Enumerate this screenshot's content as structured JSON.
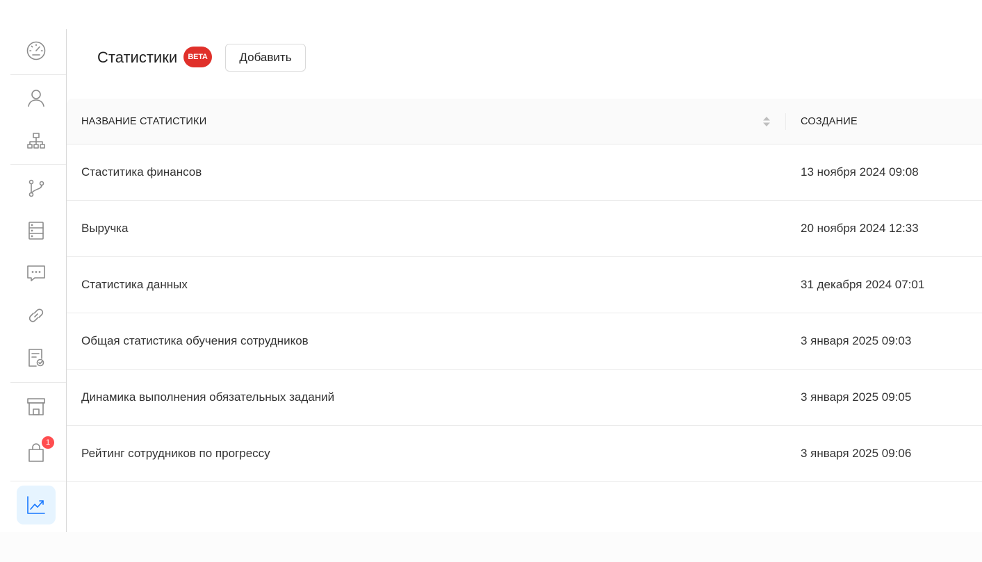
{
  "header": {
    "title": "Статистики",
    "beta_label": "BETA",
    "add_button_label": "Добавить"
  },
  "sidebar": {
    "items": [
      {
        "name": "dashboard",
        "icon": "speedometer-icon"
      },
      {
        "name": "users",
        "icon": "user-icon"
      },
      {
        "name": "structure",
        "icon": "org-chart-icon"
      },
      {
        "name": "branches",
        "icon": "branch-icon"
      },
      {
        "name": "database",
        "icon": "server-icon"
      },
      {
        "name": "messages",
        "icon": "chat-icon"
      },
      {
        "name": "links",
        "icon": "link-icon"
      },
      {
        "name": "tasks",
        "icon": "document-check-icon"
      },
      {
        "name": "store",
        "icon": "store-icon"
      },
      {
        "name": "purchases",
        "icon": "shopping-bag-icon",
        "badge": "1"
      },
      {
        "name": "statistics",
        "icon": "chart-line-icon",
        "active": true
      }
    ]
  },
  "table": {
    "columns": [
      "НАЗВАНИЕ СТАТИСТИКИ",
      "СОЗДАНИЕ"
    ],
    "rows": [
      {
        "name": "Стаститика финансов",
        "created": "13 ноября 2024 09:08"
      },
      {
        "name": "Выручка",
        "created": "20 ноября 2024 12:33"
      },
      {
        "name": "Статистика данных",
        "created": "31 декабря 2024 07:01"
      },
      {
        "name": "Общая статистика обучения сотрудников",
        "created": "3 января 2025 09:03"
      },
      {
        "name": "Динамика выполнения обязательных заданий",
        "created": "3 января 2025 09:05"
      },
      {
        "name": "Рейтинг сотрудников по прогрессу",
        "created": "3 января 2025 09:06"
      }
    ]
  },
  "colors": {
    "accent": "#1677ff",
    "active_bg": "#e6f4ff",
    "beta": "#e0302a",
    "badge": "#ff4d4f"
  }
}
